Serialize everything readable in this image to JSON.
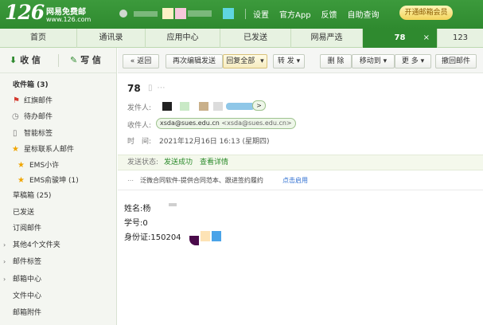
{
  "header": {
    "logo_number": "126",
    "logo_title": "网易免费邮",
    "logo_url": "www.126.com",
    "links": [
      "设置",
      "官方App",
      "反馈",
      "自助查询"
    ],
    "vip_button": "开通邮箱会员"
  },
  "tabs": [
    {
      "label": "首页"
    },
    {
      "label": "通讯录"
    },
    {
      "label": "应用中心"
    },
    {
      "label": "已发送"
    },
    {
      "label": "网易严选"
    },
    {
      "label": "78",
      "close": "×"
    },
    {
      "label": "123"
    }
  ],
  "sidebar": {
    "receive": "收 信",
    "write": "写 信",
    "items": [
      {
        "label": "收件箱 (3)"
      },
      {
        "label": "红旗邮件"
      },
      {
        "label": "待办邮件"
      },
      {
        "label": "智能标签"
      },
      {
        "label": "星标联系人邮件"
      },
      {
        "label": "EMS小许"
      },
      {
        "label": "EMS俞骏坤 (1)"
      },
      {
        "label": "草稿箱 (25)"
      },
      {
        "label": "已发送"
      },
      {
        "label": "订阅邮件"
      },
      {
        "label": "其他4个文件夹"
      },
      {
        "label": "邮件标签"
      },
      {
        "label": "邮箱中心"
      },
      {
        "label": "文件中心"
      },
      {
        "label": "邮箱附件"
      }
    ]
  },
  "toolbar": {
    "back": "返回",
    "reedit": "再次编辑发送",
    "reply_all": "回复全部",
    "forward": "转 发",
    "delete": "删 除",
    "move_to": "移动到",
    "more": "更 多",
    "recall": "撤回邮件"
  },
  "mail": {
    "subject": "78",
    "from_label": "发件人:",
    "to_label": "收件人:",
    "to_name": "xsda@sues.edu.cn",
    "to_addr": "<xsda@sues.edu.cn>",
    "time_label": "时　间:",
    "time_value": "2021年12月16日 16:13 (星期四)",
    "status_label": "发送状态:",
    "status_value": "发送成功",
    "status_link": "查看详情",
    "ad_text": "泛微合同软件-提供合同范本、跟进签约履约",
    "ad_link": "点击启用",
    "body": [
      {
        "label": "姓名:",
        "value": "杨"
      },
      {
        "label": "学号:",
        "value": "0"
      },
      {
        "label": "身份证:",
        "value": "150204"
      }
    ]
  },
  "colors": {
    "brand_green": "#2f8a2f",
    "link_green": "#2a8a2a",
    "ad_link": "#2f6fd1"
  }
}
